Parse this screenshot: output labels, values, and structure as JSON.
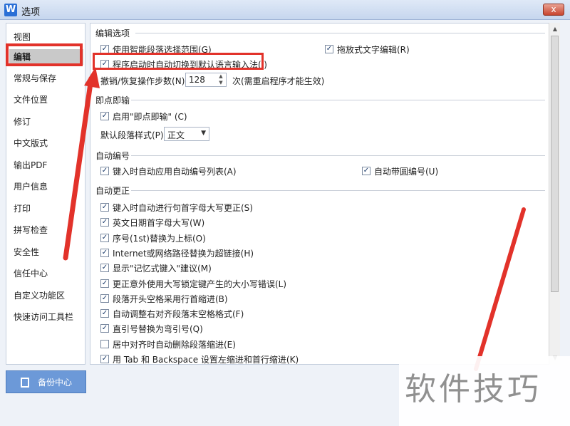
{
  "window": {
    "app_logo": "W",
    "title": "选项",
    "close_label": "x"
  },
  "sidebar": {
    "items": [
      "视图",
      "编辑",
      "常规与保存",
      "文件位置",
      "修订",
      "中文版式",
      "输出PDF",
      "用户信息",
      "打印",
      "拼写检查",
      "安全性",
      "信任中心",
      "自定义功能区",
      "快速访问工具栏"
    ],
    "active_index": 1
  },
  "backup": {
    "label": "备份中心"
  },
  "edit_options": {
    "heading": "编辑选项",
    "smart_select": "使用智能段落选择范围(G)",
    "drag_edit": "拖放式文字编辑(R)",
    "auto_ime": "程序启动时自动切换到默认语言输入法(I)",
    "undo_label": "撤销/恢复操作步数(N):",
    "undo_value": "128",
    "undo_suffix": "次(需重启程序才能生效)"
  },
  "click_type": {
    "heading": "即点即输",
    "enable": "启用\"即点即输\" (C)",
    "default_style_label": "默认段落样式(P):",
    "default_style_value": "正文"
  },
  "auto_number": {
    "heading": "自动编号",
    "apply_list": "键入时自动应用自动编号列表(A)",
    "circled": "自动带圆编号(U)"
  },
  "auto_correct": {
    "heading": "自动更正",
    "items": [
      {
        "label": "键入时自动进行句首字母大写更正(S)",
        "checked": true
      },
      {
        "label": "英文日期首字母大写(W)",
        "checked": true
      },
      {
        "label": "序号(1st)替换为上标(O)",
        "checked": true
      },
      {
        "label": "Internet或网络路径替换为超链接(H)",
        "checked": true
      },
      {
        "label": "显示\"记忆式键入\"建议(M)",
        "checked": true
      },
      {
        "label": "更正意外使用大写锁定键产生的大小写错误(L)",
        "checked": true
      },
      {
        "label": "段落开头空格采用行首缩进(B)",
        "checked": true
      },
      {
        "label": "自动调整右对齐段落末空格格式(F)",
        "checked": true
      },
      {
        "label": "直引号替换为弯引号(Q)",
        "checked": true
      },
      {
        "label": "居中对齐时自动删除段落缩进(E)",
        "checked": false
      },
      {
        "label": "用 Tab 和 Backspace 设置左缩进和首行缩进(K)",
        "checked": true
      }
    ]
  },
  "watermark": "软件技巧",
  "colors": {
    "highlight": "#e2322a",
    "accent": "#6c99d8"
  }
}
